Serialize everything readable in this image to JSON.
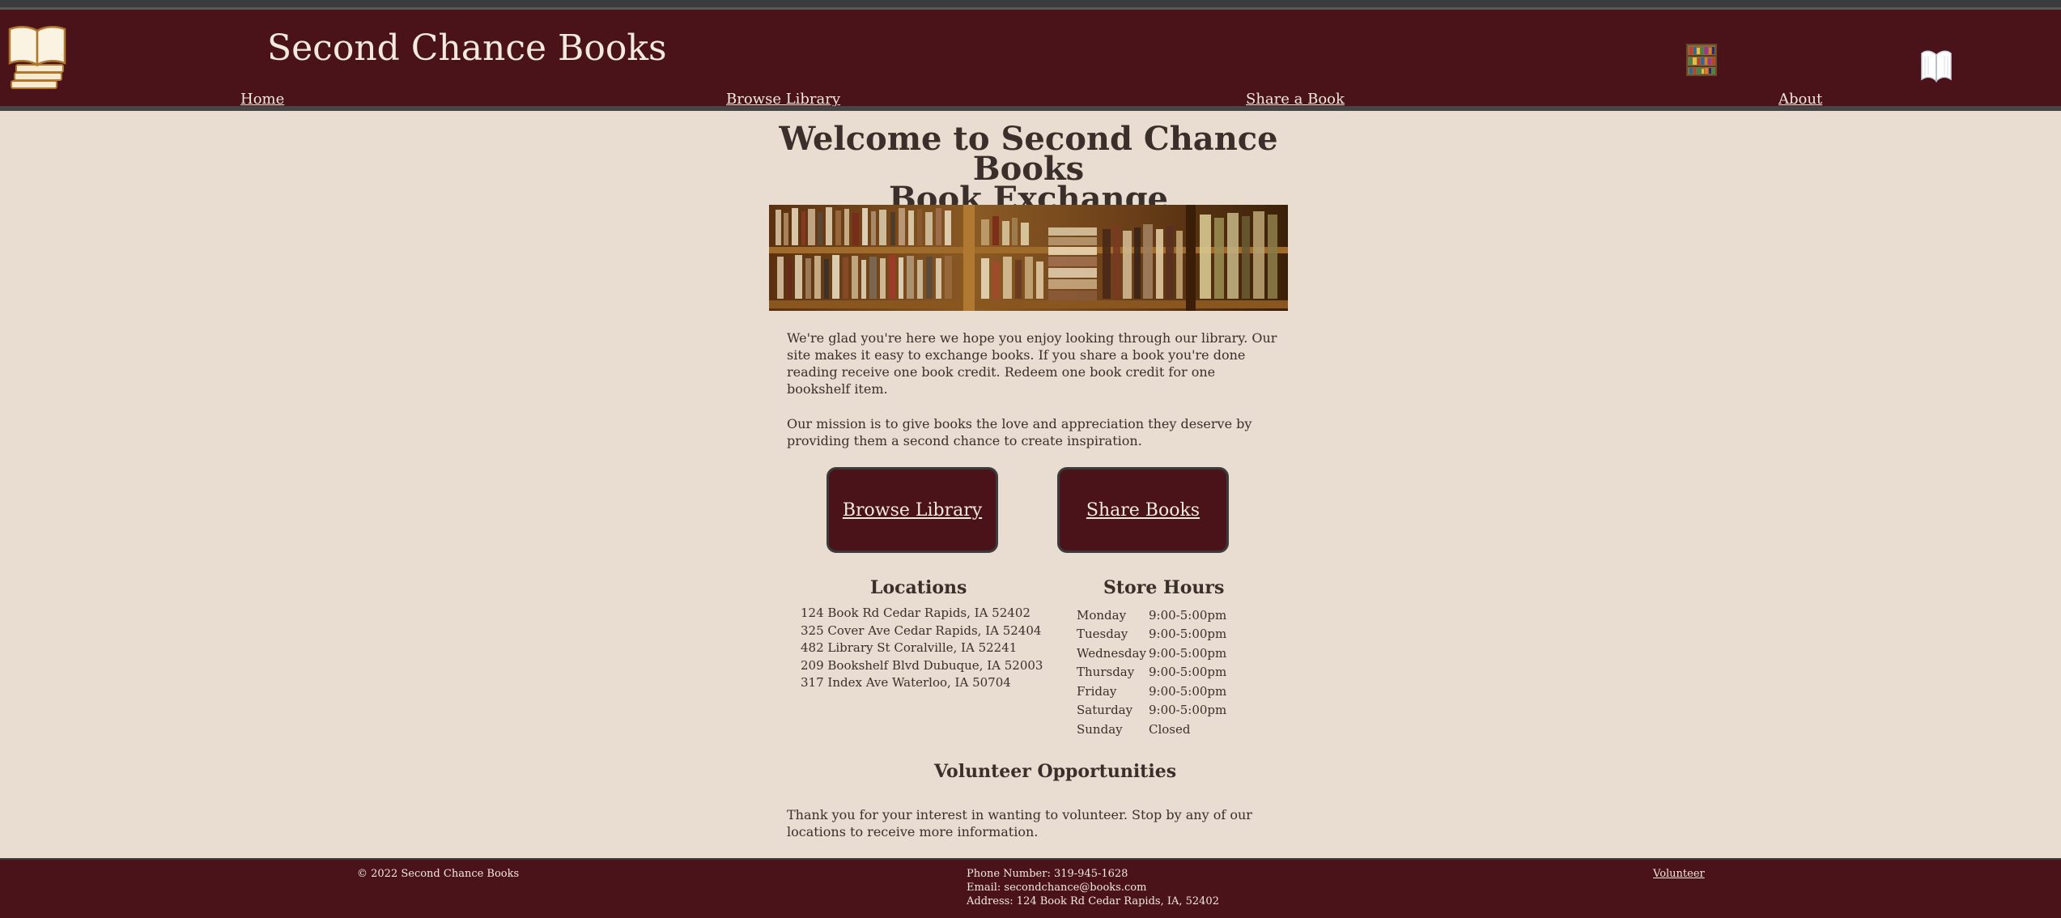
{
  "header": {
    "title": "Second Chance Books",
    "nav": [
      "Home",
      "Browse Library",
      "Share a Book",
      "About"
    ]
  },
  "main": {
    "welcome_line1": "Welcome to Second Chance Books",
    "welcome_line2": "Book Exchange",
    "intro": "We're glad you're here we hope you enjoy looking through our library. Our site makes it easy to exchange books. If you share a book you're done reading receive one book credit. Redeem one book credit for one bookshelf item.",
    "mission": "Our mission is to give books the love and appreciation they deserve by providing them a second chance to create inspiration.",
    "buttons": [
      "Browse Library",
      "Share Books"
    ],
    "locations": {
      "heading": "Locations",
      "items": [
        "124 Book Rd Cedar Rapids, IA 52402",
        "325 Cover Ave Cedar Rapids, IA 52404",
        "482 Library St Coralville, IA 52241",
        "209 Bookshelf Blvd Dubuque, IA 52003",
        "317 Index Ave Waterloo, IA 50704"
      ]
    },
    "hours": {
      "heading": "Store Hours",
      "rows": [
        {
          "day": "Monday",
          "time": "9:00-5:00pm"
        },
        {
          "day": "Tuesday",
          "time": "9:00-5:00pm"
        },
        {
          "day": "Wednesday",
          "time": "9:00-5:00pm"
        },
        {
          "day": "Thursday",
          "time": "9:00-5:00pm"
        },
        {
          "day": "Friday",
          "time": "9:00-5:00pm"
        },
        {
          "day": "Saturday",
          "time": "9:00-5:00pm"
        },
        {
          "day": "Sunday",
          "time": "Closed"
        }
      ]
    },
    "volunteer": {
      "heading": "Volunteer Opportunities",
      "text": "Thank you for your interest in wanting to volunteer. Stop by any of our locations to receive more information."
    }
  },
  "footer": {
    "copyright": "© 2022 Second Chance Books",
    "phone": "Phone Number: 319-945-1628",
    "email": "Email: secondchance@books.com",
    "address": "Address: 124 Book Rd Cedar Rapids, IA, 52402",
    "volunteer_link": "Volunteer"
  },
  "colors": {
    "header_bg": "#4a1219",
    "page_bg": "#e8ddd0",
    "text": "#3a2f2a",
    "header_text": "#f3e9dd"
  },
  "icons": [
    "open-book-logo-icon",
    "bookshelf-icon",
    "open-book-icon",
    "library-banner-image"
  ]
}
